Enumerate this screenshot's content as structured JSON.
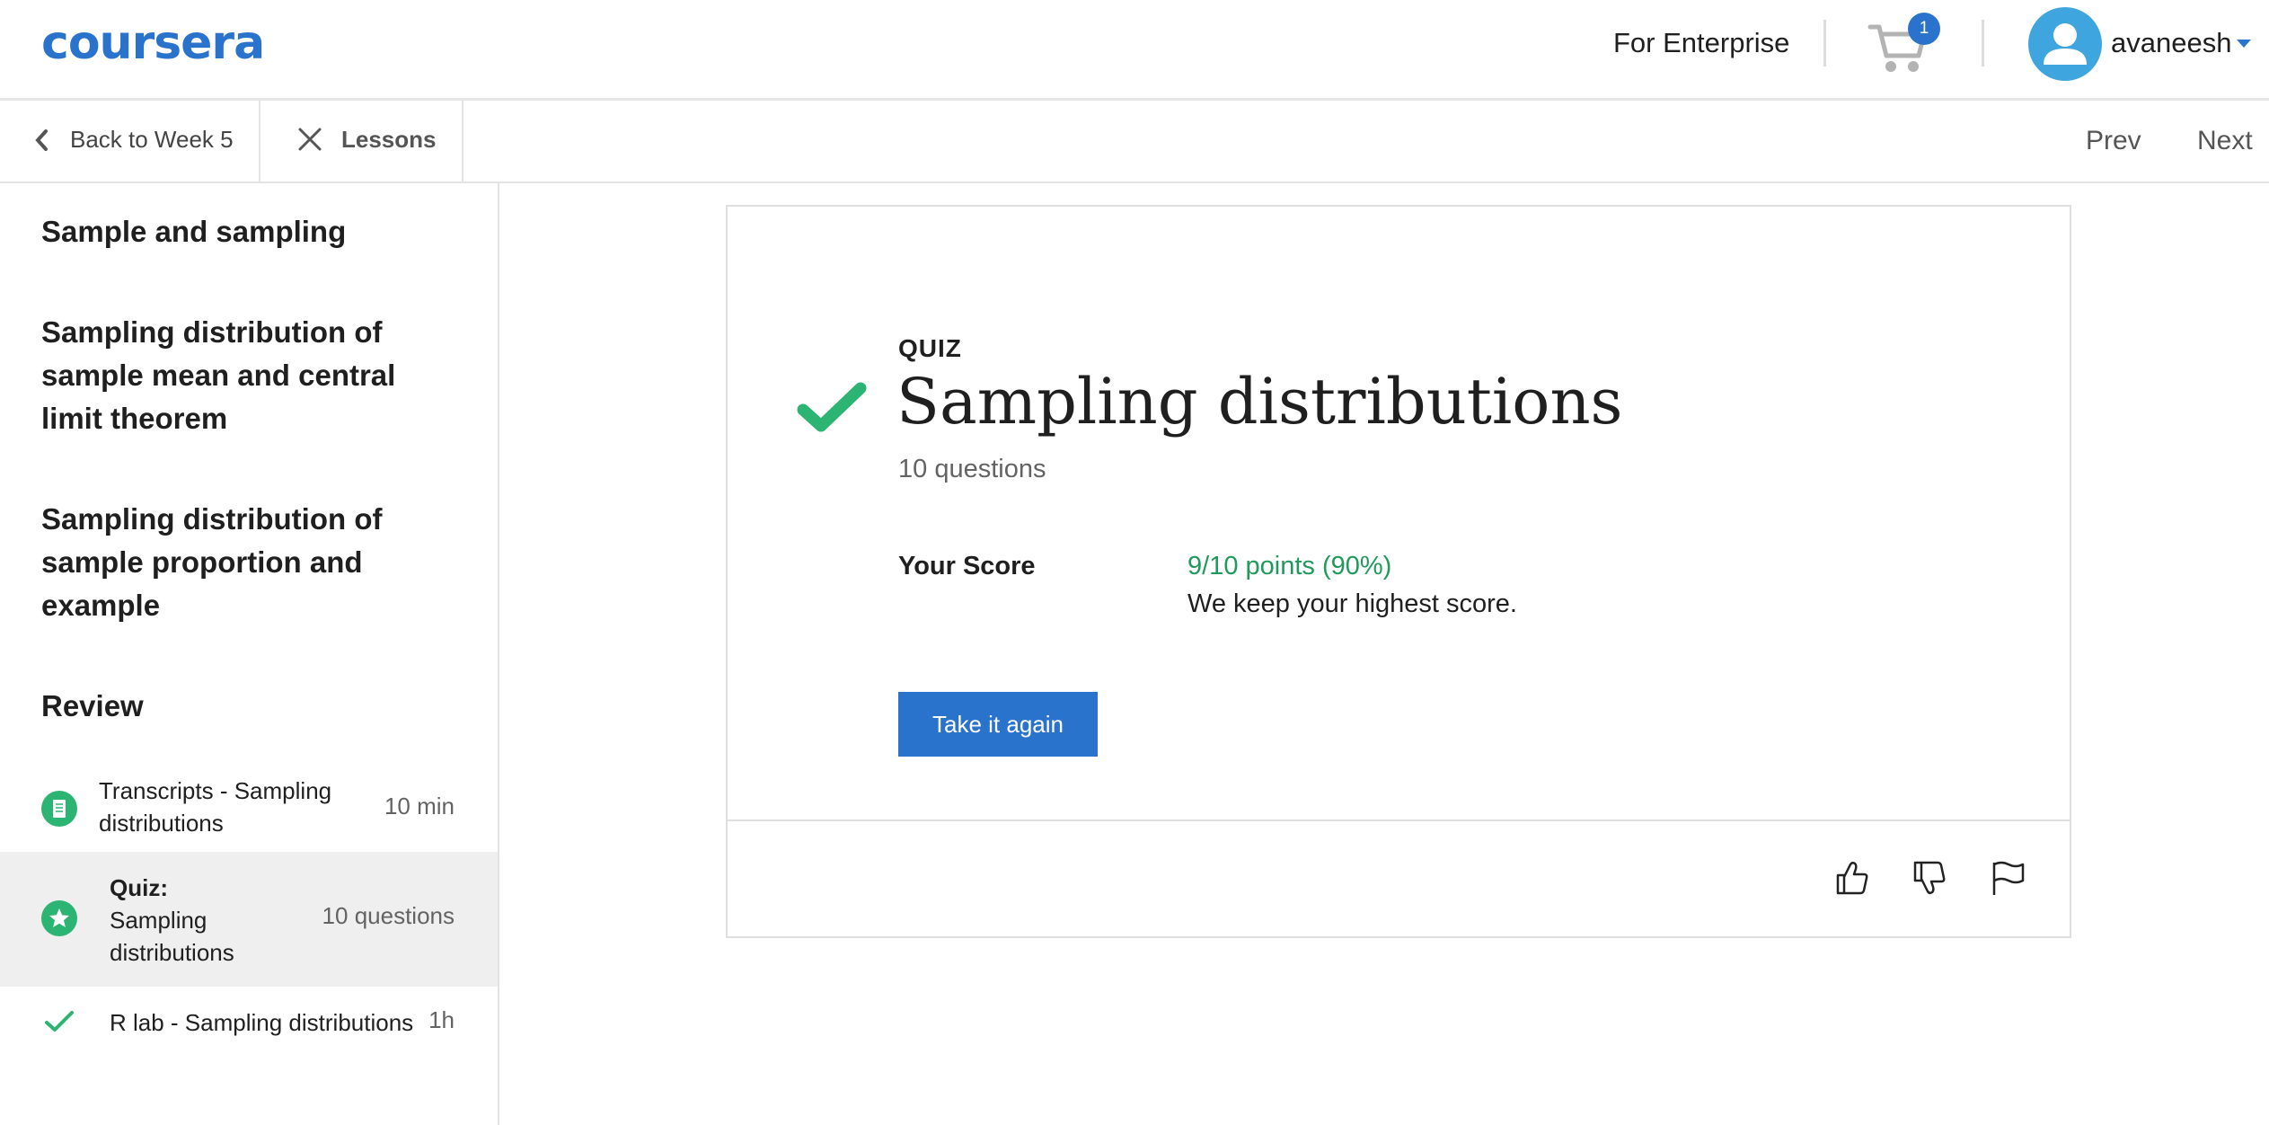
{
  "header": {
    "logo_text": "coursera",
    "for_enterprise": "For Enterprise",
    "cart_count": "1",
    "username": "avaneesh",
    "brand_color": "#2a73cc"
  },
  "subnav": {
    "back_label": "Back to Week 5",
    "lessons_label": "Lessons",
    "prev_label": "Prev",
    "next_label": "Next"
  },
  "sidebar": {
    "sections": [
      {
        "title": "Sample and sampling"
      },
      {
        "title": "Sampling distribution of sample mean and central limit theorem"
      },
      {
        "title": "Sampling distribution of sample proportion and example"
      },
      {
        "title": "Review"
      }
    ],
    "items": [
      {
        "icon": "reading-icon",
        "title": "Transcripts - Sampling distributions",
        "meta": "10 min",
        "active": false
      },
      {
        "icon": "quiz-star-icon",
        "kind": "Quiz:",
        "title": "Sampling distributions",
        "meta": "10 questions",
        "active": true
      },
      {
        "icon": "check-icon",
        "title": "R lab - Sampling distributions",
        "meta": "1h",
        "active": false
      }
    ]
  },
  "quiz": {
    "label": "QUIZ",
    "title": "Sampling distributions",
    "question_count": "10 questions",
    "score_label": "Your Score",
    "score_value": "9/10 points (90%)",
    "score_note": "We keep your highest score.",
    "retake_label": "Take it again",
    "passed_color": "#1f9a5b"
  },
  "feedback": {
    "icons": [
      "thumbs-up-icon",
      "thumbs-down-icon",
      "flag-icon"
    ]
  }
}
